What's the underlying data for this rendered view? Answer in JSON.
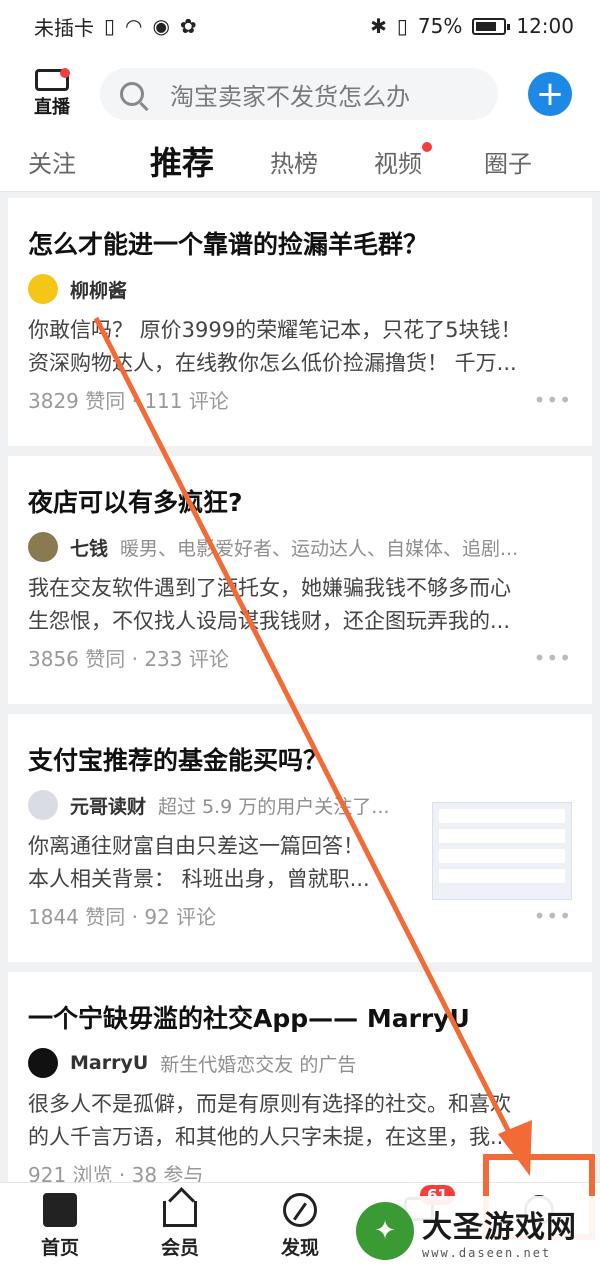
{
  "status_bar": {
    "carrier": "未插卡",
    "battery": "75%",
    "time": "12:00"
  },
  "top_bar": {
    "live_label": "直播",
    "search_placeholder": "淘宝卖家不发货怎么办"
  },
  "tabs": [
    {
      "label": "关注",
      "active": false
    },
    {
      "label": "推荐",
      "active": true
    },
    {
      "label": "热榜",
      "active": false
    },
    {
      "label": "视频",
      "active": false,
      "red_dot": true
    },
    {
      "label": "圈子",
      "active": false
    }
  ],
  "feed": [
    {
      "title": "怎么才能进一个靠谱的捡漏羊毛群？",
      "author": "柳柳酱",
      "author_desc": "",
      "excerpt_line1": "你敢信吗？ 原价3999的荣耀笔记本，只花了5块钱！",
      "excerpt_line2": "资深购物达人，在线教你怎么低价捡漏撸货！ 千万...",
      "stats": "3829 赞同 · 111 评论"
    },
    {
      "title": "夜店可以有多疯狂?",
      "author": "七钱",
      "author_desc": "暖男、电影爱好者、运动达人、自媒体、追剧...",
      "excerpt_line1": "我在交友软件遇到了酒托女，她嫌骗我钱不够多而心",
      "excerpt_line2": "生怨恨，不仅找人设局谋我钱财，还企图玩弄我的...",
      "stats": "3856 赞同 · 233 评论"
    },
    {
      "title": "支付宝推荐的基金能买吗？",
      "author": "元哥读财",
      "author_desc": "超过 5.9 万的用户关注了...",
      "excerpt_line1": "你离通往财富自由只差这一篇回答！",
      "excerpt_line2": "本人相关背景： 科班出身，曾就职...",
      "stats": "1844 赞同 · 92 评论"
    },
    {
      "title": "一个宁缺毋滥的社交App—— MarryU",
      "author": "MarryU",
      "author_desc": "新生代婚恋交友 的广告",
      "excerpt_line1": "很多人不是孤僻，而是有原则有选择的社交。和喜欢",
      "excerpt_line2": "的人千言万语，和其他的人只字未提，在这里，我...",
      "stats": "921 浏览 · 38 参与"
    }
  ],
  "bottom_nav": [
    {
      "label": "首页",
      "icon": "home-icon"
    },
    {
      "label": "会员",
      "icon": "member-icon"
    },
    {
      "label": "发现",
      "icon": "discover-icon"
    }
  ],
  "message_badge": "61",
  "more_glyph": "•••",
  "watermark": {
    "title": "大圣游戏网",
    "url": "www.daseen.net"
  },
  "colors": {
    "accent_blue": "#1e88e5",
    "badge_red": "#f1403c",
    "annotation_orange": "#f26a35"
  }
}
